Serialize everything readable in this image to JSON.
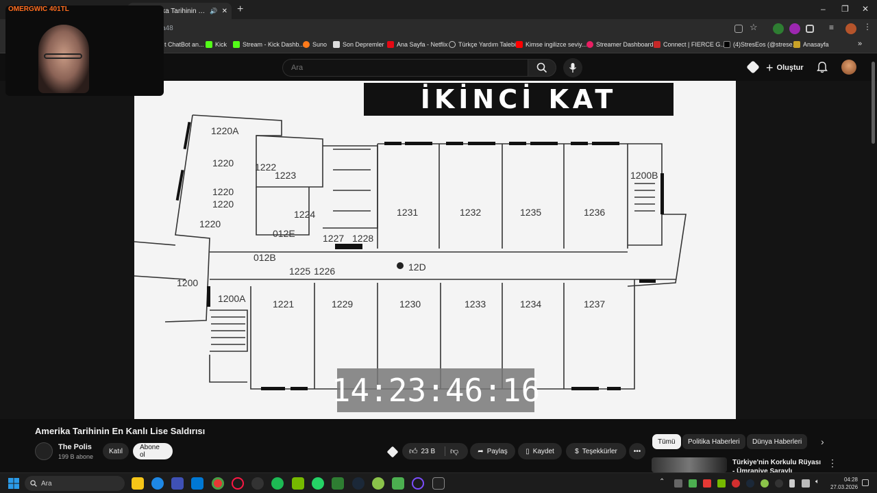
{
  "browser": {
    "active_tab_title": "Amerika Tarihinin En Kanlı L",
    "url_fragment": "a48",
    "bookmarks": [
      "t ChatBot an...",
      "Kick",
      "Stream - Kick Dashb...",
      "Suno",
      "Son Depremler",
      "Ana Sayfa - Netflix",
      "Türkçe Yardım Talebi",
      "Kimse ingilizce seviy...",
      "Streamer Dashboard",
      "Connect | FIERCE G...",
      "(4)StresEos (@strese...",
      "Anasayfa"
    ],
    "window_controls": [
      "–",
      "❐",
      "✕"
    ]
  },
  "webcam": {
    "title": "OMERGWIC 401TL"
  },
  "youtube": {
    "search_placeholder": "Ara",
    "create_label": "Oluştur"
  },
  "video": {
    "banner": "İKİNCİ KAT",
    "timestamp": "14:23:46:16",
    "rooms": [
      "1220A",
      "1220",
      "1220",
      "1220",
      "1222",
      "1223",
      "1224",
      "1220",
      "1231",
      "1232",
      "1235",
      "1236",
      "1200B",
      "012E",
      "1227",
      "1228",
      "012B",
      "1225",
      "1226",
      "12D",
      "1200",
      "1200A",
      "1221",
      "1229",
      "1230",
      "1233",
      "1234",
      "1237"
    ]
  },
  "info": {
    "title": "Amerika Tarihinin En Kanlı Lise Saldırısı",
    "channel_name": "The Polis",
    "subscribers": "199 B abone",
    "join_label": "Katıl",
    "subscribe_label": "Abone ol",
    "like_count": "23 B",
    "share_label": "Paylaş",
    "save_label": "Kaydet",
    "thanks_label": "Teşekkürler",
    "more_label": "•••"
  },
  "chips": [
    "Tümü",
    "Politika Haberleri",
    "Dünya Haberleri"
  ],
  "recommendation": {
    "title": "Türkiye'nin Korkulu Rüyası - Ümraniye Saraylı"
  },
  "taskbar": {
    "search_label": "Ara",
    "time": "04:28",
    "date": "27.03.2026"
  },
  "colors": {
    "accent_red": "#ff0000",
    "cam_title": "#ff6d1f"
  }
}
